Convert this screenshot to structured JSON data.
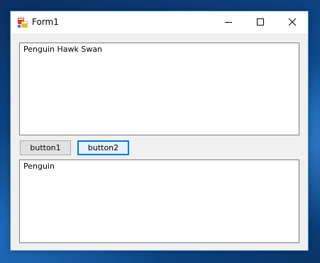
{
  "window": {
    "title": "Form1"
  },
  "titlebar": {
    "icons": [
      "app-icon",
      "minimize-icon",
      "maximize-icon",
      "close-icon"
    ]
  },
  "textbox1": {
    "value": "Penguin Hawk Swan"
  },
  "buttons": {
    "button1_label": "button1",
    "button2_label": "button2"
  },
  "textbox2": {
    "value": "Penguin"
  },
  "colors": {
    "accent": "#0078d7",
    "window_border": "#3b7fd0",
    "form_background": "#f0f0f0",
    "desktop": "#0d4a8c"
  }
}
